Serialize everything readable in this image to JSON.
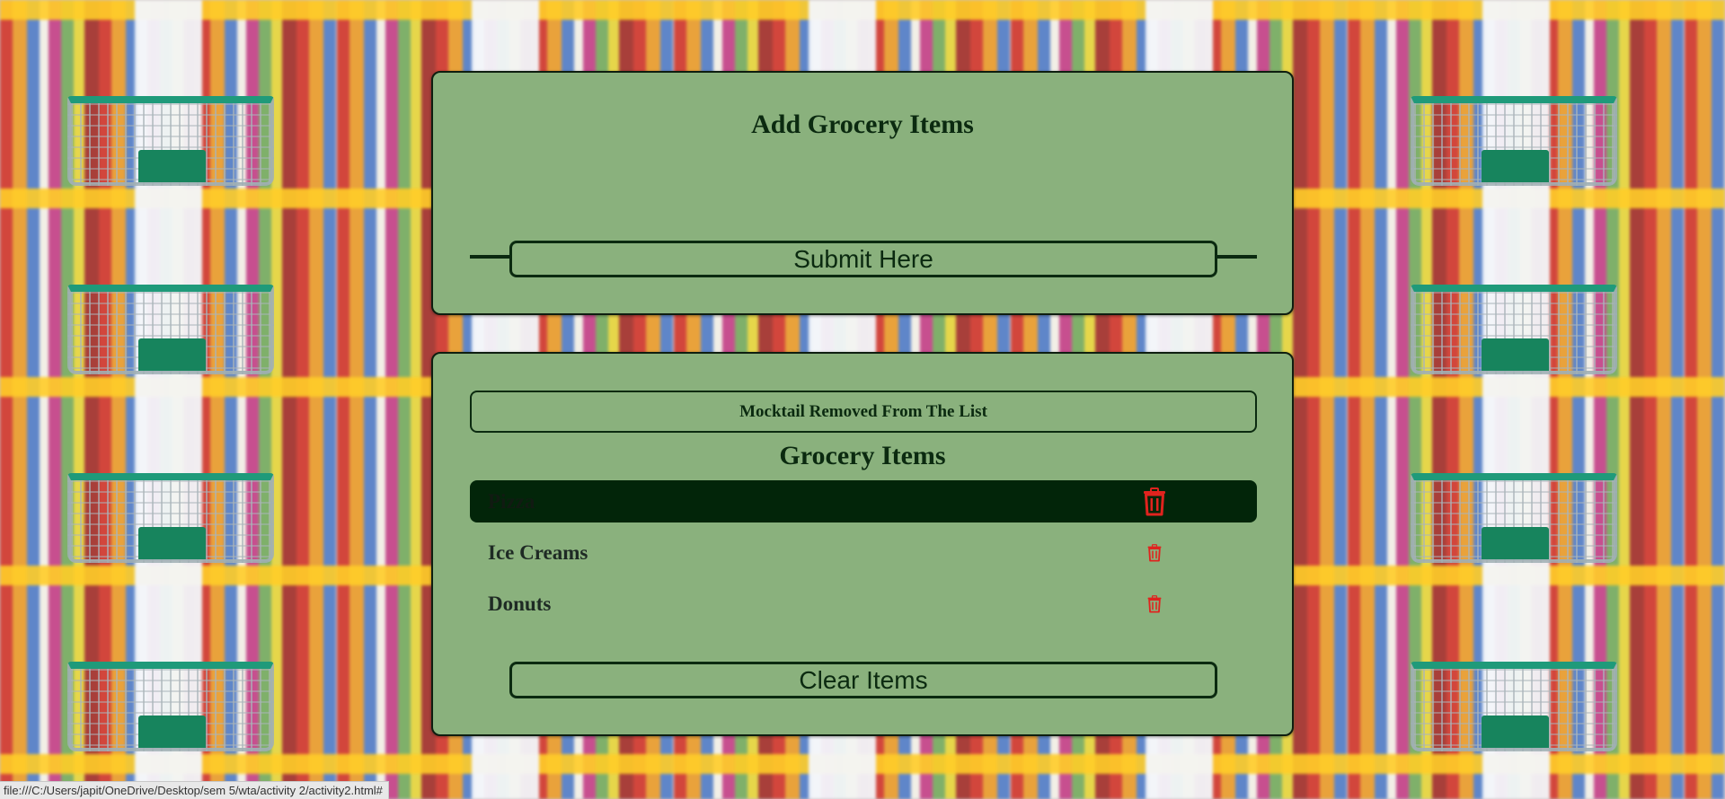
{
  "add_panel": {
    "title": "Add Grocery Items",
    "input_value": "",
    "submit_label": "Submit Here"
  },
  "list_panel": {
    "alert_message": "Mocktail Removed From The List",
    "title": "Grocery Items",
    "items": [
      {
        "name": "Pizza",
        "highlighted": true,
        "delete_icon": "trash-icon"
      },
      {
        "name": "Ice Creams",
        "highlighted": false,
        "delete_icon": "trash-icon"
      },
      {
        "name": "Donuts",
        "highlighted": false,
        "delete_icon": "trash-icon"
      }
    ],
    "clear_label": "Clear Items"
  },
  "status_bar": {
    "url": "file:///C:/Users/japit/OneDrive/Desktop/sem 5/wta/activity 2/activity2.html#"
  },
  "colors": {
    "panel_bg": "#8ab17d",
    "dark_green": "#0b2a10",
    "highlight_row": "#022509",
    "delete_red": "#e0231e"
  }
}
